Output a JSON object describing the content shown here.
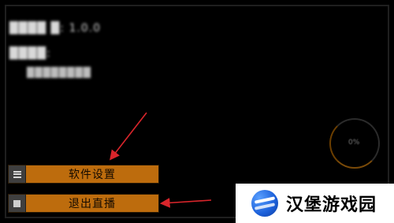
{
  "overlay": {
    "line1": "████ █: 1.0.0",
    "line2": "████:",
    "line3": "████████"
  },
  "status_ring": {
    "text": "0%"
  },
  "menu": {
    "settings_label": "软件设置",
    "exit_label": "退出直播"
  },
  "watermark": {
    "text": "汉堡游戏园"
  },
  "colors": {
    "button": "#bd6c0d",
    "arrow": "#d9252b",
    "logo": "#1b5fd9"
  }
}
